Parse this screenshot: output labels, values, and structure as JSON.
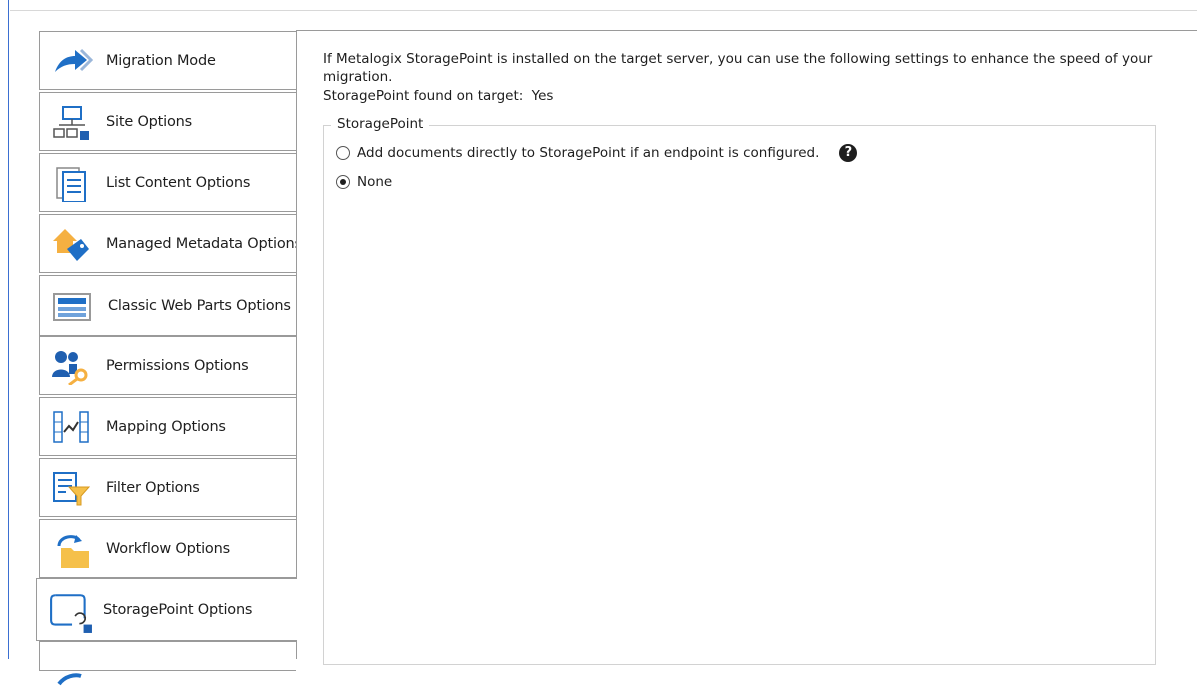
{
  "sidebar": {
    "items": [
      {
        "label": "Migration Mode",
        "icon": "migration-arrow-icon"
      },
      {
        "label": "Site Options",
        "icon": "site-hierarchy-icon"
      },
      {
        "label": "List Content Options",
        "icon": "list-content-icon"
      },
      {
        "label": "Managed Metadata Options",
        "icon": "metadata-tag-icon"
      },
      {
        "label": "Classic Web Parts Options",
        "icon": "web-parts-icon"
      },
      {
        "label": "Permissions Options",
        "icon": "permissions-users-key-icon"
      },
      {
        "label": "Mapping Options",
        "icon": "mapping-icon"
      },
      {
        "label": "Filter Options",
        "icon": "filter-icon"
      },
      {
        "label": "Workflow Options",
        "icon": "workflow-icon"
      },
      {
        "label": "StoragePoint Options",
        "icon": "storagepoint-icon",
        "selected": true
      }
    ]
  },
  "content": {
    "intro_line1": "If Metalogix StoragePoint is installed on the target server, you can use the following settings to enhance the speed of your",
    "intro_line2": "migration.",
    "found_label": "StoragePoint found on target:",
    "found_value": "Yes",
    "group_title": "StoragePoint",
    "options": [
      {
        "label": "Add documents directly to StoragePoint if an endpoint is configured.",
        "checked": false
      },
      {
        "label": "None",
        "checked": true
      }
    ],
    "help_icon": "question-circle-icon"
  }
}
